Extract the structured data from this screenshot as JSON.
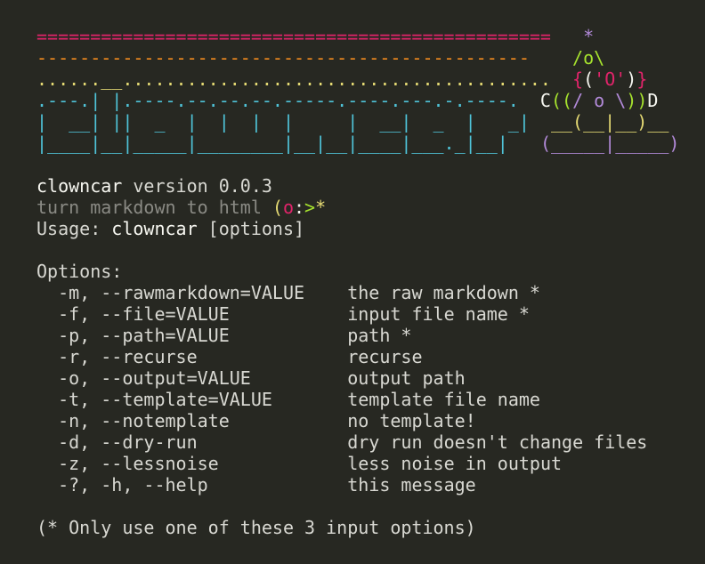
{
  "banner": {
    "lines": [
      [
        {
          "text": "================================================  ",
          "color": "red"
        },
        {
          "text": " *",
          "color": "purple"
        }
      ],
      [
        {
          "text": "----------------------------------------------  ",
          "color": "orange"
        },
        {
          "text": "  /o\\",
          "color": "green"
        }
      ],
      [
        {
          "text": "......__........................................ ",
          "color": "yellow"
        },
        {
          "text": " {",
          "color": "red"
        },
        {
          "text": "(",
          "color": "white"
        },
        {
          "text": "'O'",
          "color": "red"
        },
        {
          "text": ")",
          "color": "white"
        },
        {
          "text": "}",
          "color": "red"
        }
      ],
      [
        {
          "text": ".---.| |.----.--.--.--.-----.----.---.-.----. ",
          "color": "cyan"
        },
        {
          "text": " C",
          "color": "white"
        },
        {
          "text": "((",
          "color": "green"
        },
        {
          "text": "/ o \\",
          "color": "purple"
        },
        {
          "text": "))",
          "color": "green"
        },
        {
          "text": "D",
          "color": "white"
        }
      ],
      [
        {
          "text": "|  __| ||  _  |  |  |  |     |  __|  _  |   _| ",
          "color": "cyan"
        },
        {
          "text": " __(__|__)__",
          "color": "yellow"
        }
      ],
      [
        {
          "text": "|____|__|_____|________|__|__|____|___._|__|   ",
          "color": "cyan"
        },
        {
          "text": "(_____|_____)",
          "color": "purple"
        }
      ]
    ]
  },
  "info": {
    "app_name": "clowncar",
    "version_label": " version 0.0.3",
    "tagline": "turn markdown to html ",
    "tagline_face": [
      {
        "text": "(",
        "color": "yellow"
      },
      {
        "text": "o",
        "color": "red"
      },
      {
        "text": ":",
        "color": "white"
      },
      {
        "text": ">",
        "color": "green"
      },
      {
        "text": "*",
        "color": "yellow"
      }
    ],
    "usage_prefix": "Usage: ",
    "usage_cmd": "clowncar",
    "usage_suffix": " [options]"
  },
  "options": {
    "heading": "Options:",
    "items": [
      {
        "flag": "  -m, --rawmarkdown=VALUE    ",
        "desc": "the raw markdown *"
      },
      {
        "flag": "  -f, --file=VALUE           ",
        "desc": "input file name *"
      },
      {
        "flag": "  -p, --path=VALUE           ",
        "desc": "path *"
      },
      {
        "flag": "  -r, --recurse              ",
        "desc": "recurse"
      },
      {
        "flag": "  -o, --output=VALUE         ",
        "desc": "output path"
      },
      {
        "flag": "  -t, --template=VALUE       ",
        "desc": "template file name"
      },
      {
        "flag": "  -n, --notemplate           ",
        "desc": "no template!"
      },
      {
        "flag": "  -d, --dry-run              ",
        "desc": "dry run doesn't change files"
      },
      {
        "flag": "  -z, --lessnoise            ",
        "desc": "less noise in output"
      },
      {
        "flag": "  -?, -h, --help             ",
        "desc": "this message"
      }
    ],
    "footnote": "(* Only use one of these 3 input options)"
  },
  "colors": {
    "background": "#272822",
    "red": "#e0246a",
    "orange": "#f28b1e",
    "yellow": "#e6db74",
    "cyan": "#4fc3d8",
    "green": "#a6e22e",
    "purple": "#b28ad9",
    "white": "#f8f8f2",
    "gray": "#8a8a84"
  }
}
